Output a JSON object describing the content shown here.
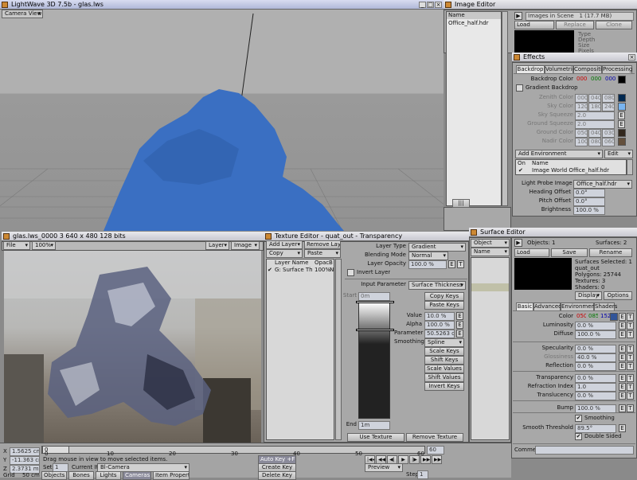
{
  "main": {
    "title": "LightWave 3D 7.5b - glas.lws",
    "view": "Camera View"
  },
  "image_editor": {
    "title": "Image Editor",
    "list_header": "Name",
    "item": "Office_half.hdr",
    "images_in_scene": "Images in Scene",
    "count": "1 (17.7 MB)",
    "load": "Load",
    "replace": "Replace",
    "clone": "Clone",
    "info": [
      "Type",
      "Depth",
      "Size",
      "Pixels"
    ]
  },
  "effects": {
    "title": "Effects",
    "tabs": [
      "Backdrop",
      "Volumetrics",
      "Compositing",
      "Processing"
    ],
    "backdrop_label": "Backdrop Color",
    "backdrop_rgb": [
      "000",
      "000",
      "000"
    ],
    "gradient_label": "Gradient Backdrop",
    "grad_rows": [
      {
        "label": "Zenith Color",
        "v": [
          "000",
          "040",
          "080"
        ],
        "color": "#002850"
      },
      {
        "label": "Sky Color",
        "v": [
          "120",
          "180",
          "240"
        ],
        "color": "#78b4f0"
      },
      {
        "label": "Sky Squeeze",
        "v": [
          "2.0"
        ]
      },
      {
        "label": "Ground Squeeze",
        "v": [
          "2.0"
        ]
      },
      {
        "label": "Ground Color",
        "v": [
          "050",
          "040",
          "030"
        ],
        "color": "#32281e"
      },
      {
        "label": "Nadir Color",
        "v": [
          "100",
          "080",
          "060"
        ],
        "color": "#64503c"
      }
    ],
    "add_env": "Add Environment",
    "edit": "Edit",
    "env_headers": [
      "On",
      "Name"
    ],
    "env_item": "Image World Office_half.hdr",
    "env_check": "✔",
    "probe_label": "Light Probe Image",
    "probe_value": "Office_half.hdr",
    "heading_label": "Heading Offset",
    "heading_value": "0.0°",
    "pitch_label": "Pitch Offset",
    "pitch_value": "0.0°",
    "bright_label": "Brightness",
    "bright_value": "100.0 %"
  },
  "render": {
    "title": "glas.lws_0000 3  640 x 480 128 bits",
    "file": "File",
    "zoom": "100%",
    "layer": "Layer",
    "image": "Image"
  },
  "texture": {
    "title": "Texture Editor - quat_out - Transparency",
    "add_layer": "Add Layer",
    "remove_layer": "Remove Layer",
    "copy": "Copy",
    "paste": "Paste",
    "list_headers": [
      "Layer Name",
      "Opac",
      "B"
    ],
    "layer_row": [
      "G: Surface Thick…",
      "100%",
      "N"
    ],
    "layer_check": "✔",
    "layer_type_label": "Layer Type",
    "layer_type": "Gradient",
    "blend_label": "Blending Mode",
    "blend": "Normal",
    "opacity_label": "Layer Opacity",
    "opacity": "100.0 %",
    "invert_layer": "Invert Layer",
    "input_label": "Input Parameter",
    "input": "Surface Thickness",
    "start_label": "Start",
    "start_value": "0m",
    "copy_keys": "Copy Keys",
    "paste_keys": "Paste Keys",
    "value_label": "Value",
    "value": "10.0 %",
    "alpha_label": "Alpha",
    "alpha": "100.0 %",
    "param_label": "Parameter",
    "param": "50.5263 cm",
    "smooth_label": "Smoothing",
    "smooth": "Spline",
    "scale_keys": "Scale Keys",
    "shift_keys": "Shift Keys",
    "scale_values": "Scale Values",
    "shift_values": "Shift Values",
    "invert_keys": "Invert Keys",
    "end_label": "End",
    "end_value": "1m",
    "use_texture": "Use Texture",
    "remove_texture": "Remove Texture"
  },
  "surface": {
    "title": "Surface Editor",
    "object_label": "Object",
    "name_label": "Name",
    "objects": "Objects: 1",
    "surfaces": "Surfaces: 2",
    "load": "Load",
    "save": "Save",
    "rename": "Rename",
    "info": [
      "Surfaces Selected: 1",
      "quat_out",
      "Polygons: 25744",
      "Textures: 3",
      "Shaders: 0"
    ],
    "display": "Display",
    "options": "Options",
    "tabs": [
      "Basic",
      "Advanced",
      "Environment",
      "Shaders"
    ],
    "color_label": "Color",
    "color_rgb": [
      "050",
      "085",
      "152"
    ],
    "rows": [
      {
        "label": "Luminosity",
        "value": "0.0 %"
      },
      {
        "label": "Diffuse",
        "value": "100.0 %"
      },
      {
        "label": "Specularity",
        "value": "0.0 %"
      },
      {
        "label": "Glossiness",
        "value": "40.0 %"
      },
      {
        "label": "Reflection",
        "value": "0.0 %"
      },
      {
        "label": "Transparency",
        "value": "0.0 %"
      },
      {
        "label": "Refraction Index",
        "value": "1.0"
      },
      {
        "label": "Translucency",
        "value": "0.0 %"
      },
      {
        "label": "Bump",
        "value": "100.0 %"
      }
    ],
    "smoothing": "Smoothing",
    "smooth_threshold_label": "Smooth Threshold",
    "smooth_threshold": "89.5°",
    "double_sided": "Double Sided",
    "check": "✔",
    "comment_label": "Comment"
  },
  "timeline": {
    "ticks": [
      "0",
      "10",
      "20",
      "30",
      "40",
      "50",
      "60"
    ],
    "frame": "0",
    "end_frame": "60",
    "x_label": "X",
    "y_label": "Y",
    "z_label": "Z",
    "x_val": "1.5625 cm",
    "y_val": "-11.363 cm",
    "z_val": "2.3731 m",
    "grid_label": "Grid",
    "grid_val": "50 cm",
    "status": "Drag mouse in view to move selected items.",
    "set": "Set",
    "set_val": "1",
    "current_item_label": "Current Item",
    "current_item": "Bl-Camera",
    "objects": "Objects",
    "bones": "Bones",
    "lights": "Lights",
    "cameras": "Cameras",
    "item_props": "Item Properties",
    "auto_key": "Auto Key",
    "auto_key_val": "+F1",
    "create_key": "Create Key",
    "delete_key": "Delete Key",
    "preview": "Preview",
    "step": "Step",
    "step_val": "1",
    "transport": [
      "|◀◀",
      "◀◀",
      "◀|",
      "▶",
      "|▶",
      "▶▶",
      "▶▶|"
    ]
  }
}
